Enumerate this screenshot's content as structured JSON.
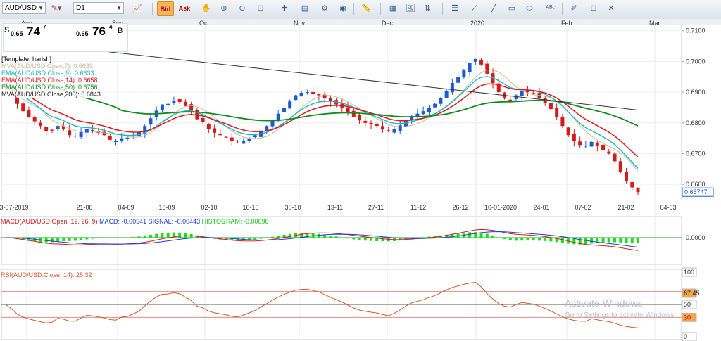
{
  "toolbar": {
    "symbol": "AUD/USD",
    "timeframe": "D1",
    "bid_label": "Bid",
    "ask_label": "Ask"
  },
  "price_panel": {
    "sell_label": "S",
    "sell_prefix": "0.65",
    "sell_big": "74",
    "sell_sup": "7",
    "buy_prefix": "0.65",
    "buy_big": "76",
    "buy_sup": "4",
    "buy_label": "B"
  },
  "legend": {
    "template": "[Template: harish]",
    "lines": [
      {
        "text": "MVA(AUD/USD.Open,7): 0.6639",
        "color": "#c9b98e"
      },
      {
        "text": "EMA(AUD/USD.Close,9): 0.6633",
        "color": "#1ab6c6"
      },
      {
        "text": "EMA(AUD/USD.Close,14): 0.6658",
        "color": "#e0161b"
      },
      {
        "text": "EMA(AUD/USD.Close,50): 0.6756",
        "color": "#118a1e"
      },
      {
        "text": "MVA(AUD/USD.Close,200): 0.6843",
        "color": "#222222"
      }
    ]
  },
  "macd": {
    "label_main": "MACD(AUD/USD.Open, 12, 26, 9)",
    "label_macd": "MACD: -0.00541",
    "label_signal": "SIGNAL: -0.00443",
    "label_hist": "HISTOGRAM: -0.00098",
    "axis_value": "0.0000"
  },
  "rsi": {
    "label": "RSI(AUD/USD.Close, 14): 25.32",
    "levels": [
      "100",
      "67.45",
      "50",
      "30",
      "0"
    ]
  },
  "watermark": {
    "title": "Activate Windows",
    "subtitle": "Go to Settings to activate Windows."
  },
  "chart_data": {
    "type": "candlestick",
    "symbol": "AUD/USD",
    "timeframe": "D1",
    "months": [
      "Aug",
      "Sep",
      "Oct",
      "Nov",
      "Dec",
      "2020",
      "Feb",
      "Mar"
    ],
    "date_ticks": [
      "3-07-2019",
      "21-08",
      "04-09",
      "18-09",
      "02-10",
      "16-10",
      "30-10",
      "13-11",
      "27-11",
      "11-12",
      "26-12",
      "10-01-2020",
      "24-01",
      "07-02",
      "21-02",
      "04-03"
    ],
    "y_ticks": [
      "0.7100",
      "0.7000",
      "0.6900",
      "0.6800",
      "0.6700",
      "0.6600"
    ],
    "ylim": [
      0.655,
      0.712
    ],
    "last_price": "0.65747",
    "colors": {
      "up": "#1c5ad4",
      "down": "#d41b1b"
    },
    "close_series": [
      0.6915,
      0.6895,
      0.6862,
      0.6838,
      0.682,
      0.6805,
      0.679,
      0.6772,
      0.6775,
      0.679,
      0.678,
      0.676,
      0.6758,
      0.677,
      0.678,
      0.6776,
      0.6768,
      0.676,
      0.6745,
      0.674,
      0.675,
      0.6752,
      0.676,
      0.677,
      0.679,
      0.6815,
      0.684,
      0.686,
      0.6862,
      0.6872,
      0.6868,
      0.6855,
      0.684,
      0.6812,
      0.6802,
      0.678,
      0.6768,
      0.676,
      0.6752,
      0.674,
      0.6735,
      0.6742,
      0.675,
      0.676,
      0.6775,
      0.679,
      0.681,
      0.683,
      0.685,
      0.687,
      0.689,
      0.6898,
      0.69,
      0.6895,
      0.689,
      0.688,
      0.687,
      0.686,
      0.685,
      0.6835,
      0.682,
      0.6808,
      0.68,
      0.6795,
      0.679,
      0.678,
      0.6772,
      0.678,
      0.6792,
      0.6808,
      0.6822,
      0.683,
      0.6838,
      0.685,
      0.6862,
      0.688,
      0.6905,
      0.693,
      0.695,
      0.6972,
      0.6995,
      0.7008,
      0.699,
      0.696,
      0.693,
      0.69,
      0.688,
      0.6872,
      0.689,
      0.6905,
      0.69,
      0.6895,
      0.6882,
      0.6865,
      0.6845,
      0.6818,
      0.679,
      0.676,
      0.674,
      0.6728,
      0.6726,
      0.6738,
      0.6725,
      0.6712,
      0.67,
      0.6675,
      0.664,
      0.6612,
      0.659,
      0.65747
    ],
    "mva200_endpoints": [
      0.7068,
      0.6842
    ],
    "macd_values": {
      "macd": -0.00541,
      "signal": -0.00443,
      "histogram": -0.00098
    },
    "rsi_value": 25.32
  }
}
